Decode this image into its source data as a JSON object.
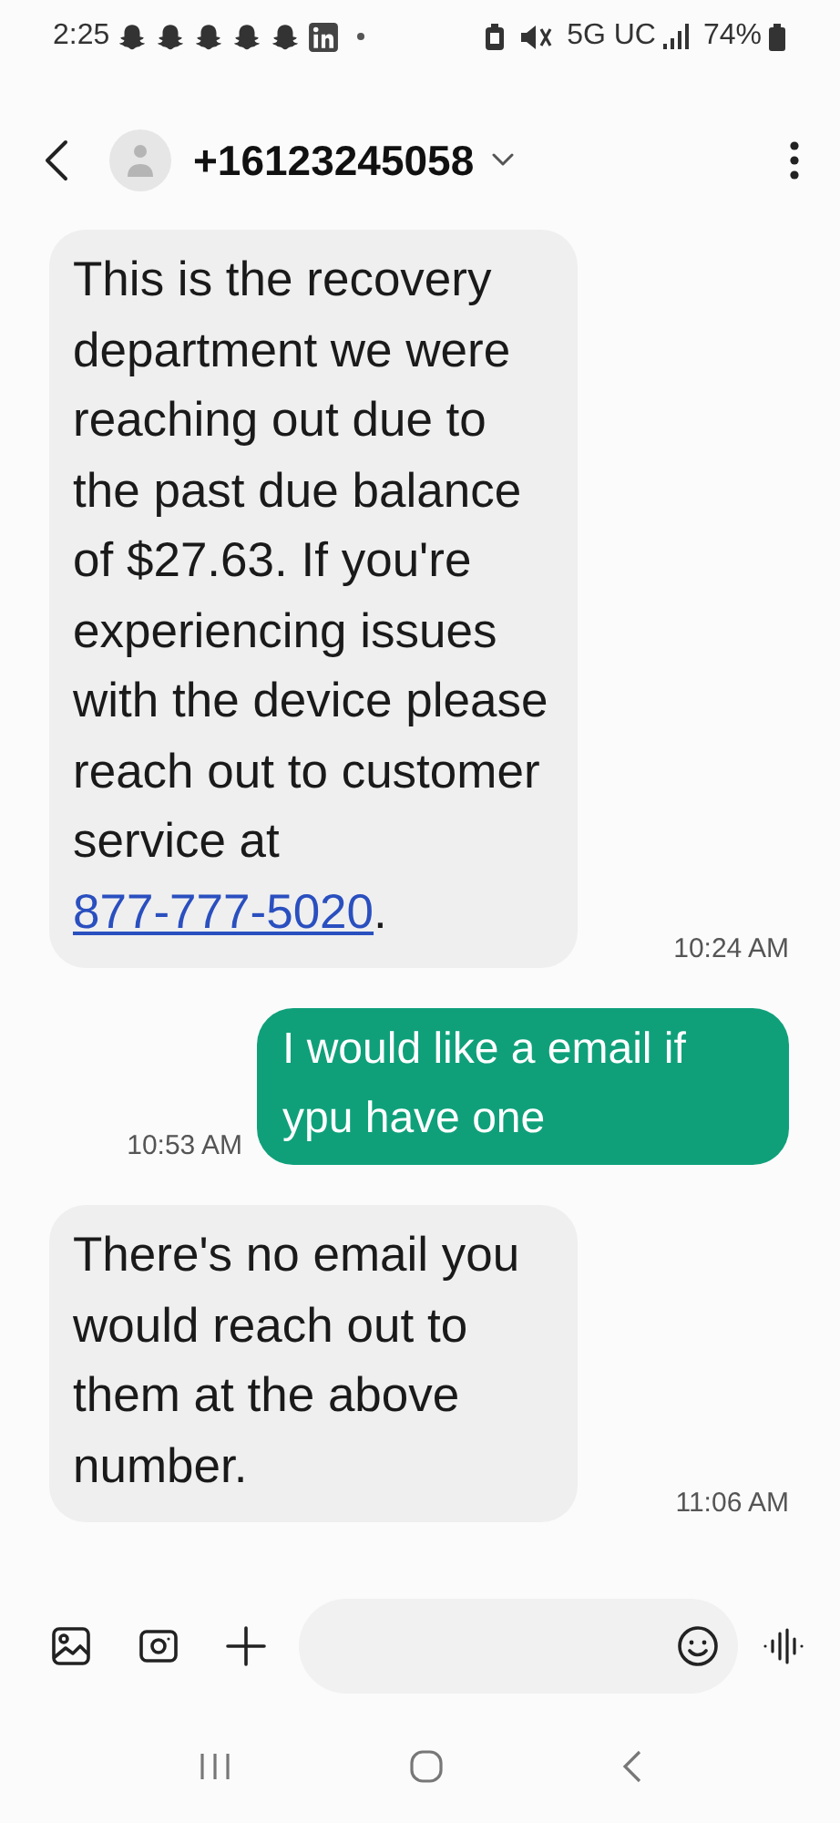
{
  "status_bar": {
    "time": "2:25",
    "notifications": [
      {
        "kind": "ghost"
      },
      {
        "kind": "ghost"
      },
      {
        "kind": "ghost"
      },
      {
        "kind": "ghost"
      },
      {
        "kind": "ghost"
      },
      {
        "kind": "linkedin"
      }
    ],
    "network": "5G UC",
    "battery": "74%"
  },
  "header": {
    "contact": "+16123245058"
  },
  "messages": [
    {
      "kind": "incoming",
      "text": "This is the recovery department we were reaching out due to the past due balance of $27.63. If you're experiencing issues with the device please reach out to customer service at ",
      "link": "877-777-5020",
      "after": ".",
      "time": "10:24 AM"
    },
    {
      "kind": "outgoing",
      "text": "I would like a email if ypu have one",
      "time": "10:53 AM"
    },
    {
      "kind": "incoming",
      "text": "There's no email you would reach out to them at the above number.",
      "time": "11:06 AM"
    }
  ]
}
